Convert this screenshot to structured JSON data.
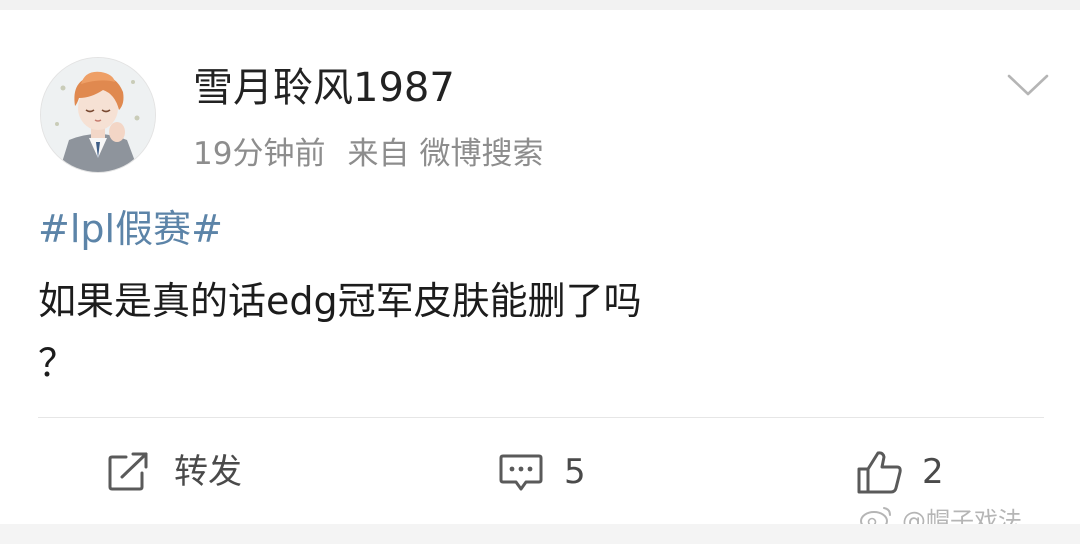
{
  "post": {
    "author": {
      "name": "雪月聆风1987"
    },
    "meta": {
      "time": "19分钟前",
      "source_label": "来自",
      "source_name": "微博搜索"
    },
    "hashtag": "#lpl假赛#",
    "body_line1": "如果是真的话edg冠军皮肤能删了吗",
    "body_line2": "？"
  },
  "actions": {
    "repost_label": "转发",
    "comment_count": "5",
    "like_count": "2"
  },
  "watermark": {
    "text": "@帽子戏法"
  },
  "icons": {
    "menu": "chevron-down-icon",
    "repost": "share-icon",
    "comment": "comment-icon",
    "like": "thumbs-up-icon"
  },
  "colors": {
    "link": "#5c84a8",
    "text": "#1c1c1c",
    "meta": "#8d8d8d"
  }
}
